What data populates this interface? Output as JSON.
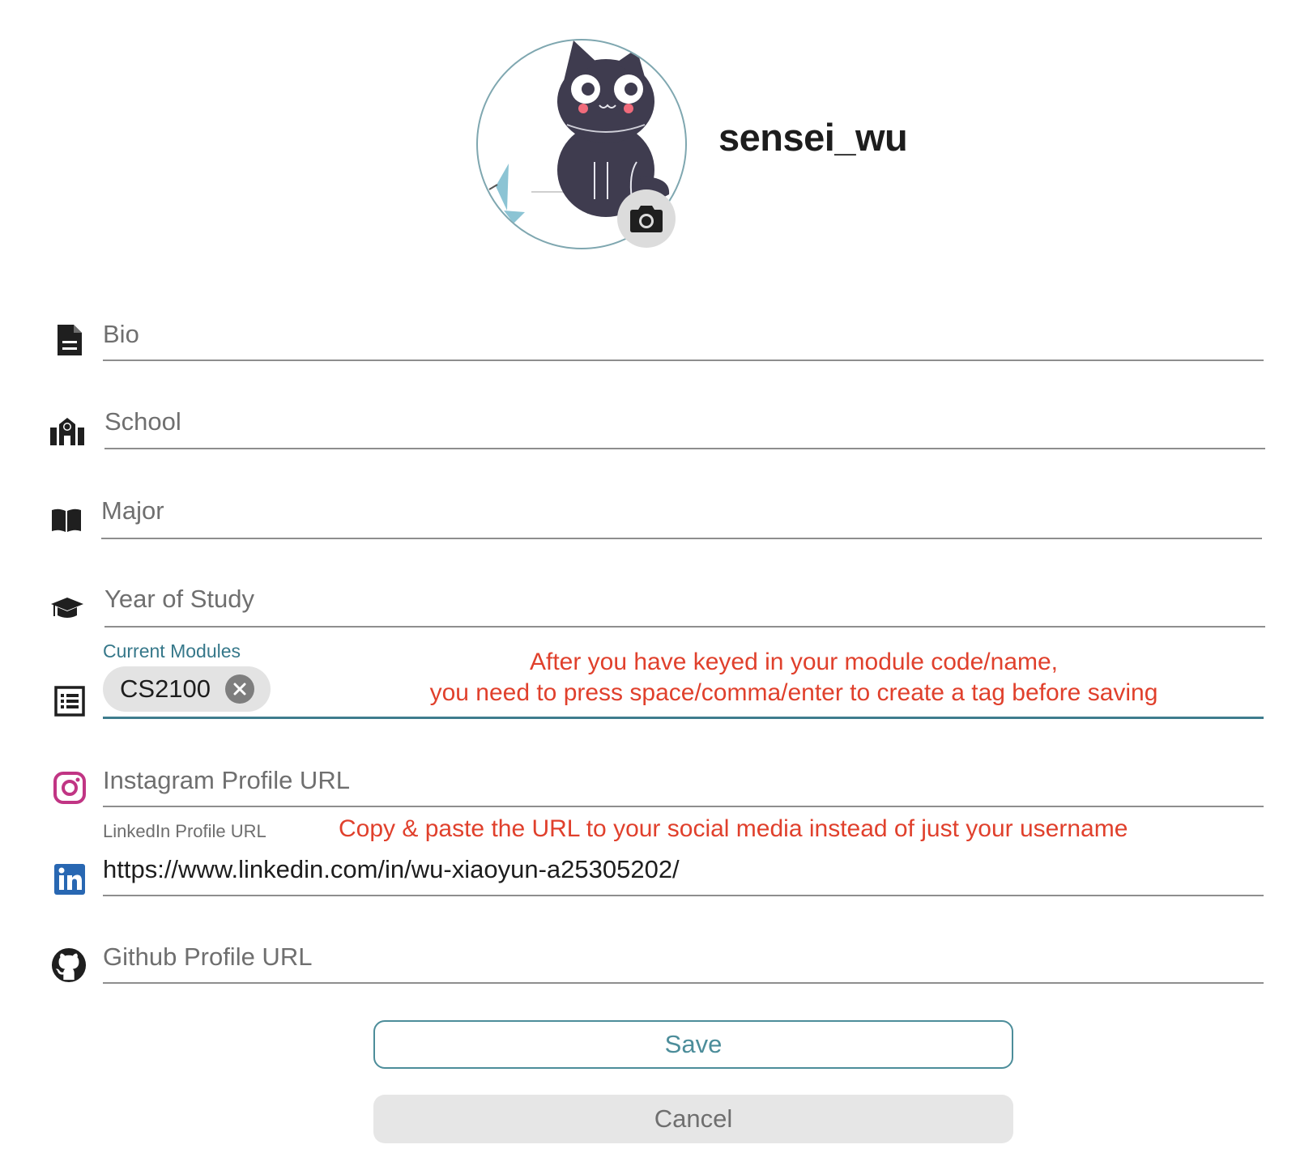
{
  "profile": {
    "username": "sensei_wu"
  },
  "fields": {
    "bio": {
      "placeholder": "Bio"
    },
    "school": {
      "placeholder": "School"
    },
    "major": {
      "placeholder": "Major"
    },
    "year": {
      "placeholder": "Year of Study"
    },
    "modules": {
      "label": "Current Modules",
      "tags": [
        "CS2100"
      ]
    },
    "instagram": {
      "placeholder": "Instagram Profile URL"
    },
    "linkedin": {
      "label": "LinkedIn Profile URL",
      "value": "https://www.linkedin.com/in/wu-xiaoyun-a25305202/"
    },
    "github": {
      "placeholder": "Github Profile URL"
    }
  },
  "hints": {
    "modules_line1": "After you have keyed in your module code/name,",
    "modules_line2": "you need to press space/comma/enter to create a tag before saving",
    "social": "Copy & paste the URL to your social media instead of just your username"
  },
  "actions": {
    "save": "Save",
    "cancel": "Cancel"
  },
  "colors": {
    "accent": "#4c8d9a",
    "hint": "#e0402c",
    "instagram": "#c13584",
    "linkedin": "#2867b2"
  },
  "icons": {
    "bio": "document-icon",
    "school": "school-icon",
    "major": "book-icon",
    "year": "graduation-cap-icon",
    "modules": "list-icon",
    "instagram": "instagram-icon",
    "linkedin": "linkedin-icon",
    "github": "github-icon",
    "camera": "camera-icon"
  }
}
